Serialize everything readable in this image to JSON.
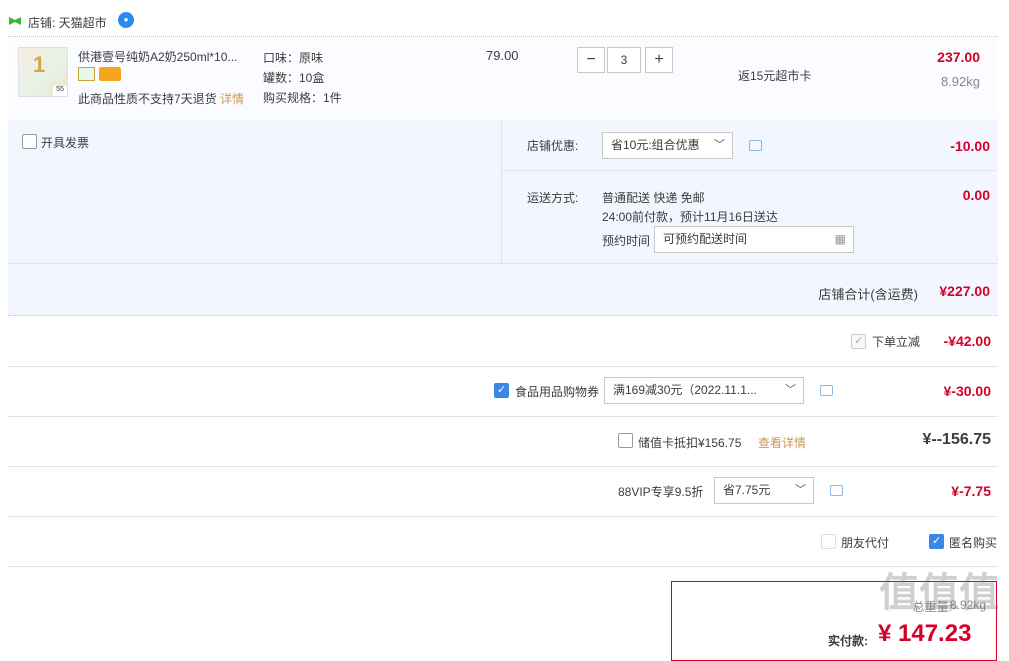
{
  "store": {
    "prefix": "店铺: ",
    "name": "天猫超市"
  },
  "item": {
    "title": "供港壹号纯奶A2奶250ml*10...",
    "thumb_badge": "55",
    "no_return": "此商品性质不支持7天退货",
    "details_link": "详情",
    "attrs": [
      "口味：原味",
      "罐数：10盒",
      "购买规格：1件"
    ],
    "unit_price": "79.00",
    "quantity": "3",
    "minus": "−",
    "plus": "+",
    "cashback": "返15元超市卡",
    "subtotal": "237.00",
    "weight": "8.92kg"
  },
  "invoice": {
    "label": "开具发票"
  },
  "store_discount": {
    "label": "店铺优惠:",
    "selected": "省10元:组合优惠",
    "amount": "-10.00"
  },
  "shipping": {
    "label": "运送方式:",
    "method": "普通配送 快递 免邮",
    "eta": "24:00前付款，预计11月16日送达",
    "reserve_label": "预约时间",
    "reserve_placeholder": "可预约配送时间",
    "amount": "0.00"
  },
  "store_total": {
    "label": "店铺合计(含运费)",
    "amount": "¥227.00"
  },
  "order_discount": {
    "label": "下单立减",
    "amount": "-¥42.00"
  },
  "coupon": {
    "label": "食品用品购物券",
    "selected": "满169减30元（2022.11.1...",
    "amount": "¥-30.00"
  },
  "stored_card": {
    "label": "储值卡抵扣¥156.75",
    "link": "查看详情",
    "amount": "¥--156.75"
  },
  "vip": {
    "label": "88VIP专享9.5折",
    "selected": "省7.75元",
    "amount": "¥-7.75"
  },
  "options": {
    "friend_pay": "朋友代付",
    "anonymous": "匿名购买"
  },
  "summary": {
    "weight_label": "总重量:",
    "weight": "8.92kg",
    "pay_label": "实付款:",
    "pay_amount": "¥ 147.23"
  },
  "watermark": "值值值"
}
